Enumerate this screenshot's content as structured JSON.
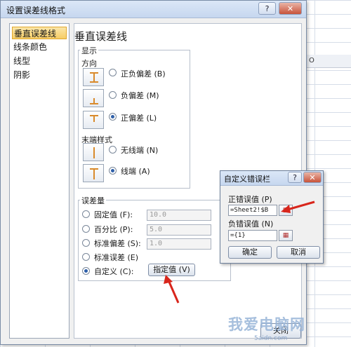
{
  "dialog": {
    "title": "设置误差线格式",
    "help_btn": "?",
    "min_btn": "–",
    "close_btn": "✕",
    "bottom_partial_button": "关闭"
  },
  "left_list": [
    {
      "label": "垂直误差线",
      "selected": true
    },
    {
      "label": "线条颜色",
      "selected": false
    },
    {
      "label": "线型",
      "selected": false
    },
    {
      "label": "阴影",
      "selected": false
    }
  ],
  "panel": {
    "title": "垂直误差线",
    "display_group": "显示",
    "direction_label": "方向",
    "direction_options": [
      {
        "label": "正负偏差 (B)",
        "selected": false
      },
      {
        "label": "负偏差 (M)",
        "selected": false
      },
      {
        "label": "正偏差 (L)",
        "selected": true
      }
    ],
    "end_style_label": "末端样式",
    "end_style_options": [
      {
        "label": "无线端 (N)",
        "selected": false
      },
      {
        "label": "线端 (A)",
        "selected": true
      }
    ],
    "error_amount_group": "误差量",
    "error_options": [
      {
        "label": "固定值 (F):",
        "value": "10.0",
        "selected": false
      },
      {
        "label": "百分比 (P):",
        "value": "5.0",
        "selected": false
      },
      {
        "label": "标准偏差 (S):",
        "value": "1.0",
        "selected": false
      },
      {
        "label": "标准误差 (E)",
        "value": "",
        "selected": false
      },
      {
        "label": "自定义 (C):",
        "value": "",
        "selected": true
      }
    ],
    "specify_button": "指定值 (V)"
  },
  "custom_dialog": {
    "title": "自定义错误栏",
    "help_btn": "?",
    "close_btn": "✕",
    "positive_label": "正错误值 (P)",
    "positive_value": "=Sheet2!$B",
    "negative_label": "负错误值 (N)",
    "negative_value": "={1}",
    "ok_button": "确定",
    "cancel_button": "取消"
  },
  "sheet": {
    "column_label": "O"
  },
  "watermark": {
    "text": "我爱电脑网",
    "url": "5aidn.com"
  },
  "colors": {
    "accent": "#2e5fa8",
    "arrow": "#d8261c",
    "selected_item": "#f6cd66"
  }
}
